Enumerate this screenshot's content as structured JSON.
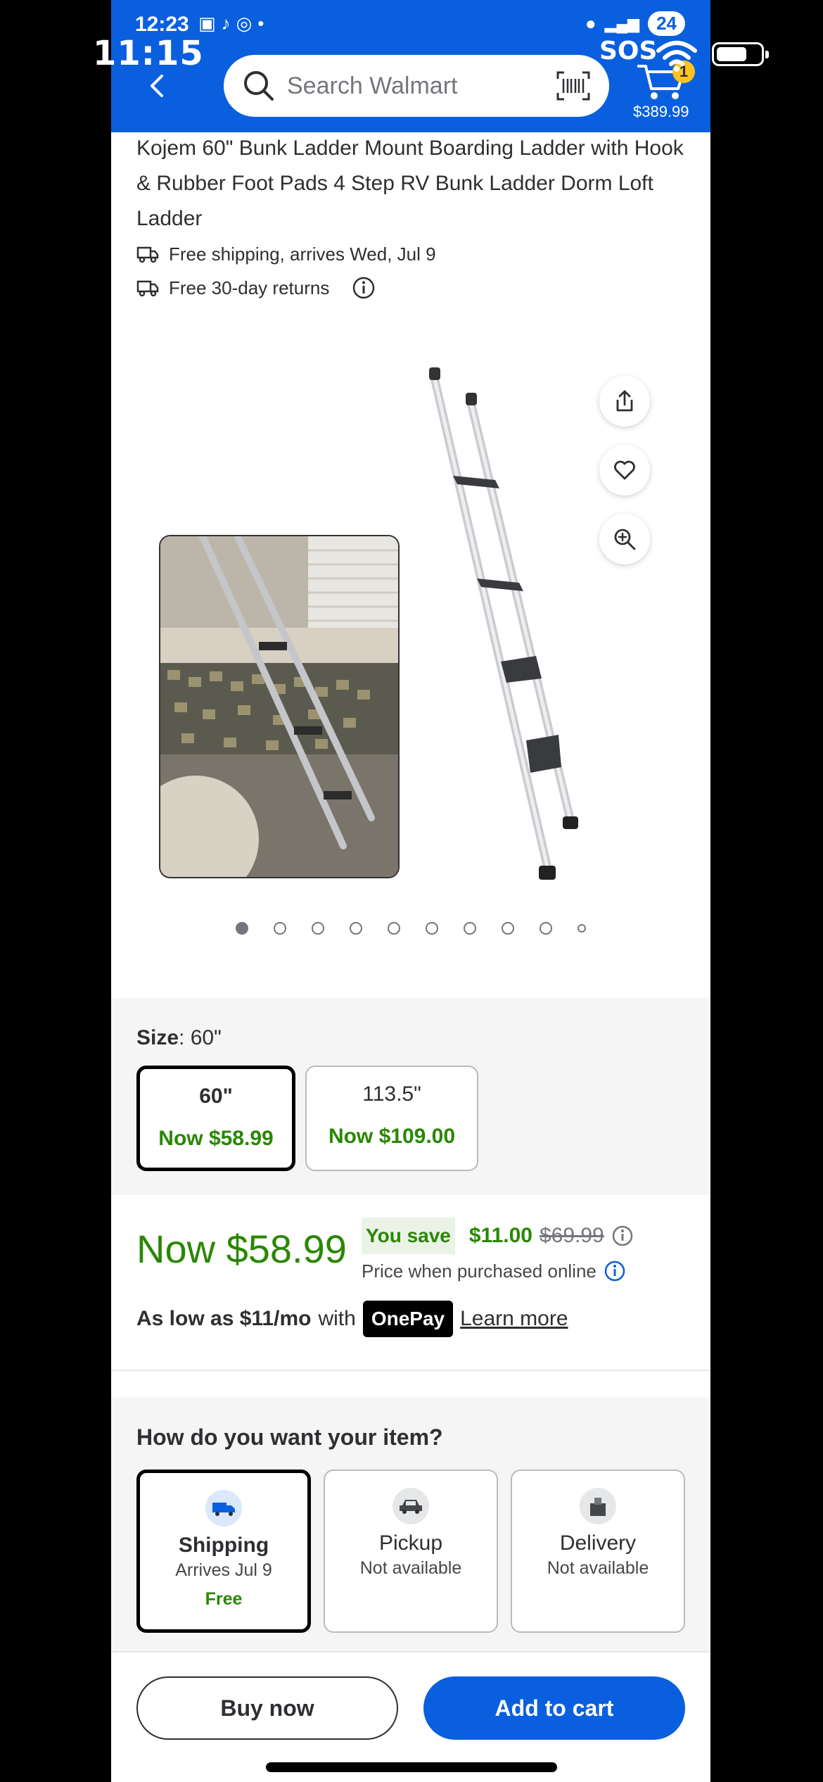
{
  "status": {
    "inner_time": "12:23",
    "outer_time": "11:15",
    "badge": "24",
    "sos": "SOS"
  },
  "header": {
    "search_placeholder": "Search Walmart",
    "cart_count": "1",
    "cart_total": "$389.99"
  },
  "product": {
    "title": "Kojem 60\" Bunk Ladder Mount Boarding Ladder with Hook & Rubber Foot Pads 4 Step RV Bunk Ladder Dorm Loft Ladder",
    "shipping_line": "Free shipping, arrives Wed, Jul 9",
    "returns_line": "Free 30-day returns"
  },
  "gallery": {
    "image_count": 10,
    "active_index": 0
  },
  "size": {
    "label": "Size",
    "selected_value": ": 60\"",
    "options": [
      {
        "size": "60\"",
        "price": "Now $58.99"
      },
      {
        "size": "113.5\"",
        "price": "Now $109.00"
      }
    ]
  },
  "price": {
    "now": "Now $58.99",
    "you_save_label": "You save",
    "save_amount": "$11.00",
    "was": "$69.99",
    "online_note": "Price when purchased online",
    "as_low_as": "As low as $11/mo",
    "with": "with",
    "onepay": "OnePay",
    "learn_more": "Learn more"
  },
  "fulfillment": {
    "title": "How do you want your item?",
    "options": [
      {
        "name": "Shipping",
        "sub": "Arrives Jul 9",
        "extra": "Free"
      },
      {
        "name": "Pickup",
        "sub": "Not available"
      },
      {
        "name": "Delivery",
        "sub": "Not available"
      }
    ]
  },
  "actions": {
    "buy_now": "Buy now",
    "add_to_cart": "Add to cart"
  },
  "colors": {
    "brand_blue": "#0a5fde",
    "price_green": "#2a8703",
    "badge_yellow": "#ffc220"
  }
}
